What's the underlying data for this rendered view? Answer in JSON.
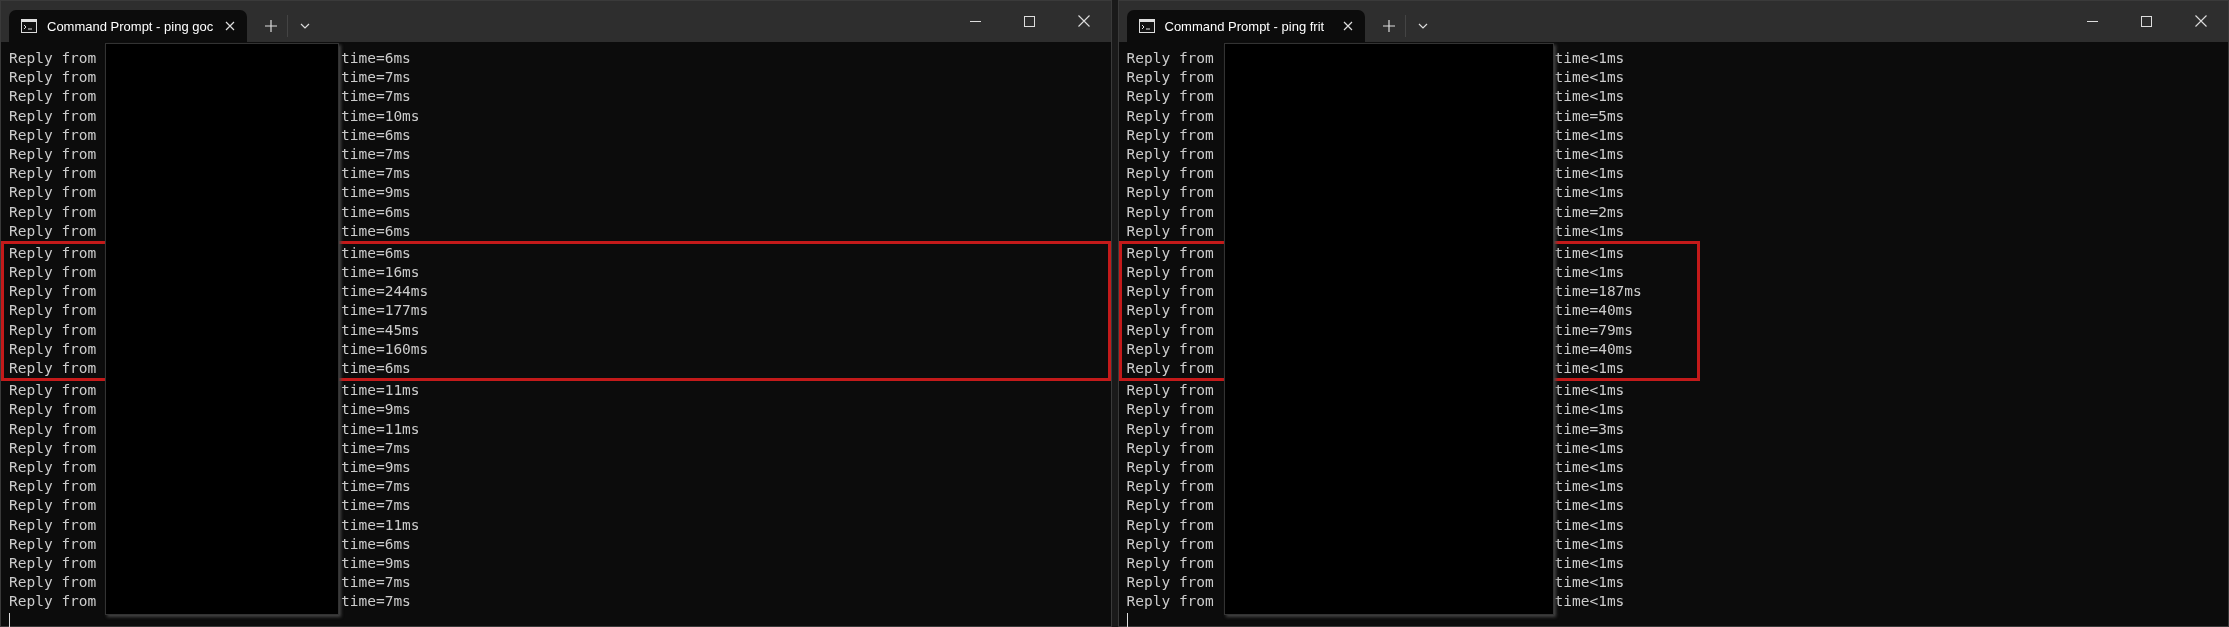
{
  "windows": [
    {
      "tab": {
        "title": "Command Prompt - ping  goc",
        "selected": true
      },
      "lines": [
        {
          "prefix": "Reply from",
          "time": "time=6ms",
          "highlighted": false
        },
        {
          "prefix": "Reply from",
          "time": "time=7ms",
          "highlighted": false
        },
        {
          "prefix": "Reply from",
          "time": "time=7ms",
          "highlighted": false
        },
        {
          "prefix": "Reply from",
          "time": "time=10ms",
          "highlighted": false
        },
        {
          "prefix": "Reply from",
          "time": "time=6ms",
          "highlighted": false
        },
        {
          "prefix": "Reply from",
          "time": "time=7ms",
          "highlighted": false
        },
        {
          "prefix": "Reply from",
          "time": "time=7ms",
          "highlighted": false
        },
        {
          "prefix": "Reply from",
          "time": "time=9ms",
          "highlighted": false
        },
        {
          "prefix": "Reply from",
          "time": "time=6ms",
          "highlighted": false
        },
        {
          "prefix": "Reply from",
          "time": "time=6ms",
          "highlighted": false
        },
        {
          "prefix": "Reply from",
          "time": "time=6ms",
          "highlighted": true
        },
        {
          "prefix": "Reply from",
          "time": "time=16ms",
          "highlighted": true
        },
        {
          "prefix": "Reply from",
          "time": "time=244ms",
          "highlighted": true
        },
        {
          "prefix": "Reply from",
          "time": "time=177ms",
          "highlighted": true
        },
        {
          "prefix": "Reply from",
          "time": "time=45ms",
          "highlighted": true
        },
        {
          "prefix": "Reply from",
          "time": "time=160ms",
          "highlighted": true
        },
        {
          "prefix": "Reply from",
          "time": "time=6ms",
          "highlighted": true
        },
        {
          "prefix": "Reply from",
          "time": "time=11ms",
          "highlighted": false
        },
        {
          "prefix": "Reply from",
          "time": "time=9ms",
          "highlighted": false
        },
        {
          "prefix": "Reply from",
          "time": "time=11ms",
          "highlighted": false
        },
        {
          "prefix": "Reply from",
          "time": "time=7ms",
          "highlighted": false
        },
        {
          "prefix": "Reply from",
          "time": "time=9ms",
          "highlighted": false
        },
        {
          "prefix": "Reply from",
          "time": "time=7ms",
          "highlighted": false
        },
        {
          "prefix": "Reply from",
          "time": "time=7ms",
          "highlighted": false
        },
        {
          "prefix": "Reply from",
          "time": "time=11ms",
          "highlighted": false
        },
        {
          "prefix": "Reply from",
          "time": "time=6ms",
          "highlighted": false
        },
        {
          "prefix": "Reply from",
          "time": "time=9ms",
          "highlighted": false
        },
        {
          "prefix": "Reply from",
          "time": "time=7ms",
          "highlighted": false
        },
        {
          "prefix": "Reply from",
          "time": "time=7ms",
          "highlighted": false
        }
      ]
    },
    {
      "tab": {
        "title": "Command Prompt - ping  frit",
        "selected": true
      },
      "lines": [
        {
          "prefix": "Reply from",
          "time": "time<1ms",
          "highlighted": false
        },
        {
          "prefix": "Reply from",
          "time": "time<1ms",
          "highlighted": false
        },
        {
          "prefix": "Reply from",
          "time": "time<1ms",
          "highlighted": false
        },
        {
          "prefix": "Reply from",
          "time": "time=5ms",
          "highlighted": false
        },
        {
          "prefix": "Reply from",
          "time": "time<1ms",
          "highlighted": false
        },
        {
          "prefix": "Reply from",
          "time": "time<1ms",
          "highlighted": false
        },
        {
          "prefix": "Reply from",
          "time": "time<1ms",
          "highlighted": false
        },
        {
          "prefix": "Reply from",
          "time": "time<1ms",
          "highlighted": false
        },
        {
          "prefix": "Reply from",
          "time": "time=2ms",
          "highlighted": false
        },
        {
          "prefix": "Reply from",
          "time": "time<1ms",
          "highlighted": false
        },
        {
          "prefix": "Reply from",
          "time": "time<1ms",
          "highlighted": true
        },
        {
          "prefix": "Reply from",
          "time": "time<1ms",
          "highlighted": true
        },
        {
          "prefix": "Reply from",
          "time": "time=187ms",
          "highlighted": true
        },
        {
          "prefix": "Reply from",
          "time": "time=40ms",
          "highlighted": true
        },
        {
          "prefix": "Reply from",
          "time": "time=79ms",
          "highlighted": true
        },
        {
          "prefix": "Reply from",
          "time": "time=40ms",
          "highlighted": true
        },
        {
          "prefix": "Reply from",
          "time": "time<1ms",
          "highlighted": true
        },
        {
          "prefix": "Reply from",
          "time": "time<1ms",
          "highlighted": false
        },
        {
          "prefix": "Reply from",
          "time": "time<1ms",
          "highlighted": false
        },
        {
          "prefix": "Reply from",
          "time": "time=3ms",
          "highlighted": false
        },
        {
          "prefix": "Reply from",
          "time": "time<1ms",
          "highlighted": false
        },
        {
          "prefix": "Reply from",
          "time": "time<1ms",
          "highlighted": false
        },
        {
          "prefix": "Reply from",
          "time": "time<1ms",
          "highlighted": false
        },
        {
          "prefix": "Reply from",
          "time": "time<1ms",
          "highlighted": false
        },
        {
          "prefix": "Reply from",
          "time": "time<1ms",
          "highlighted": false
        },
        {
          "prefix": "Reply from",
          "time": "time<1ms",
          "highlighted": false
        },
        {
          "prefix": "Reply from",
          "time": "time<1ms",
          "highlighted": false
        },
        {
          "prefix": "Reply from",
          "time": "time<1ms",
          "highlighted": false
        },
        {
          "prefix": "Reply from",
          "time": "time<1ms",
          "highlighted": false
        }
      ]
    }
  ]
}
